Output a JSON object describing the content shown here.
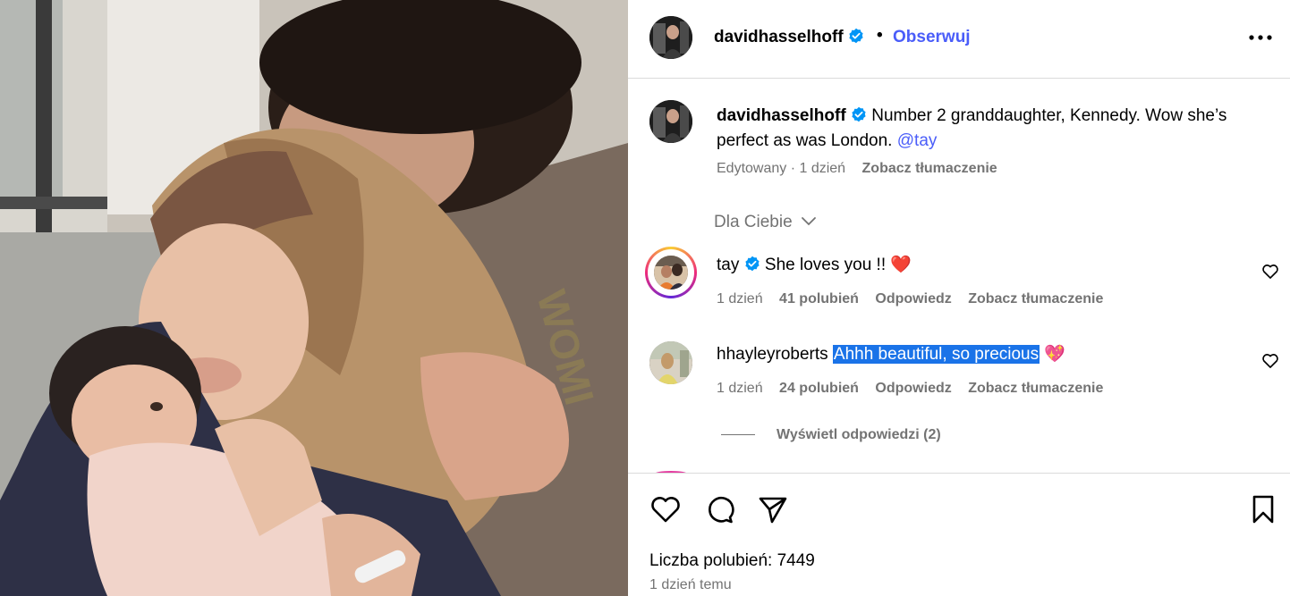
{
  "post": {
    "username": "davidhasselhoff",
    "follow_label": "Obserwuj",
    "dot": "•"
  },
  "caption": {
    "username": "davidhasselhoff",
    "text": "Number 2 granddaughter, Kennedy. Wow she’s perfect as was London.",
    "mention": "@tay",
    "edited": "Edytowany · 1 dzień",
    "see_translation": "Zobacz tłumaczenie"
  },
  "sort": {
    "label": "Dla Ciebie"
  },
  "comments": [
    {
      "username": "tay",
      "verified": true,
      "text": "She loves you !!",
      "emoji": "❤️",
      "time": "1 dzień",
      "likes": "41 polubień",
      "reply": "Odpowiedz",
      "translate": "Zobacz tłumaczenie"
    },
    {
      "username": "hhayleyroberts",
      "verified": false,
      "text": "Ahhh beautiful, so precious",
      "emoji": "💖",
      "time": "1 dzień",
      "likes": "24 polubień",
      "reply": "Odpowiedz",
      "translate": "Zobacz tłumaczenie"
    }
  ],
  "view_replies": "Wyświetl odpowiedzi (2)",
  "footer": {
    "likes_count": "Liczba polubień: 7449",
    "posted": "1 dzień temu"
  },
  "icons": {
    "header_more": "more-horizontal-icon",
    "verified": "verified-badge-icon",
    "like": "heart-icon",
    "comment": "comment-icon",
    "share": "send-icon",
    "save": "bookmark-icon",
    "sort_chevron": "chevron-down-icon"
  },
  "colors": {
    "accent": "#4a5df9",
    "verified": "#0095f6",
    "muted": "#737373",
    "selection": "#1a73e8",
    "heart_emoji": "#ff3b7f"
  }
}
